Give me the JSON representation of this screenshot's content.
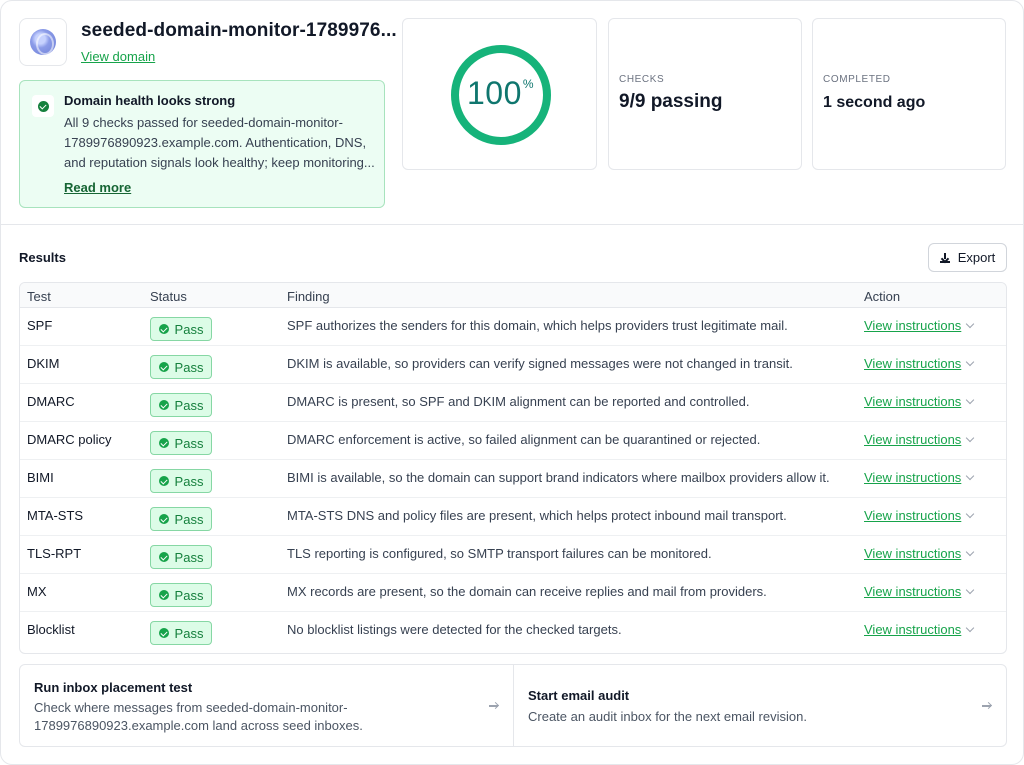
{
  "header": {
    "domain_title": "seeded-domain-monitor-1789976...",
    "view_domain_label": "View domain",
    "logo_icon": "globe-icon"
  },
  "health": {
    "title": "Domain health looks strong",
    "text": "All 9 checks passed for seeded-domain-monitor-1789976890923.example.com. Authentication, DNS, and reputation signals look healthy; keep monitoring...",
    "read_more_label": "Read more",
    "icon": "check-circle-icon"
  },
  "score": {
    "value": "100",
    "unit": "%",
    "fill_fraction": 1.0,
    "ring_color": "#16b37a"
  },
  "stats": {
    "checks_label": "CHECKS",
    "checks_value": "9/9 passing",
    "completed_label": "COMPLETED",
    "completed_value": "1 second ago"
  },
  "results": {
    "title": "Results",
    "export_label": "Export",
    "columns": {
      "test": "Test",
      "status": "Status",
      "finding": "Finding",
      "action": "Action"
    },
    "rows": [
      {
        "test": "SPF",
        "status": "Pass",
        "finding": "SPF authorizes the senders for this domain, which helps providers trust legitimate mail.",
        "action": "View instructions"
      },
      {
        "test": "DKIM",
        "status": "Pass",
        "finding": "DKIM is available, so providers can verify signed messages were not changed in transit.",
        "action": "View instructions"
      },
      {
        "test": "DMARC",
        "status": "Pass",
        "finding": "DMARC is present, so SPF and DKIM alignment can be reported and controlled.",
        "action": "View instructions"
      },
      {
        "test": "DMARC policy",
        "status": "Pass",
        "finding": "DMARC enforcement is active, so failed alignment can be quarantined or rejected.",
        "action": "View instructions"
      },
      {
        "test": "BIMI",
        "status": "Pass",
        "finding": "BIMI is available, so the domain can support brand indicators where mailbox providers allow it.",
        "action": "View instructions"
      },
      {
        "test": "MTA-STS",
        "status": "Pass",
        "finding": "MTA-STS DNS and policy files are present, which helps protect inbound mail transport.",
        "action": "View instructions"
      },
      {
        "test": "TLS-RPT",
        "status": "Pass",
        "finding": "TLS reporting is configured, so SMTP transport failures can be monitored.",
        "action": "View instructions"
      },
      {
        "test": "MX",
        "status": "Pass",
        "finding": "MX records are present, so the domain can receive replies and mail from providers.",
        "action": "View instructions"
      },
      {
        "test": "Blocklist",
        "status": "Pass",
        "finding": "No blocklist listings were detected for the checked targets.",
        "action": "View instructions"
      }
    ]
  },
  "actions": [
    {
      "title": "Run inbox placement test",
      "text": "Check where messages from seeded-domain-monitor-1789976890923.example.com land across seed inboxes."
    },
    {
      "title": "Start email audit",
      "text": "Create an audit inbox for the next email revision."
    }
  ],
  "colors": {
    "accent": "#16a34a",
    "pass_bg": "#dcfce7",
    "health_bg": "#ecfdf3"
  }
}
